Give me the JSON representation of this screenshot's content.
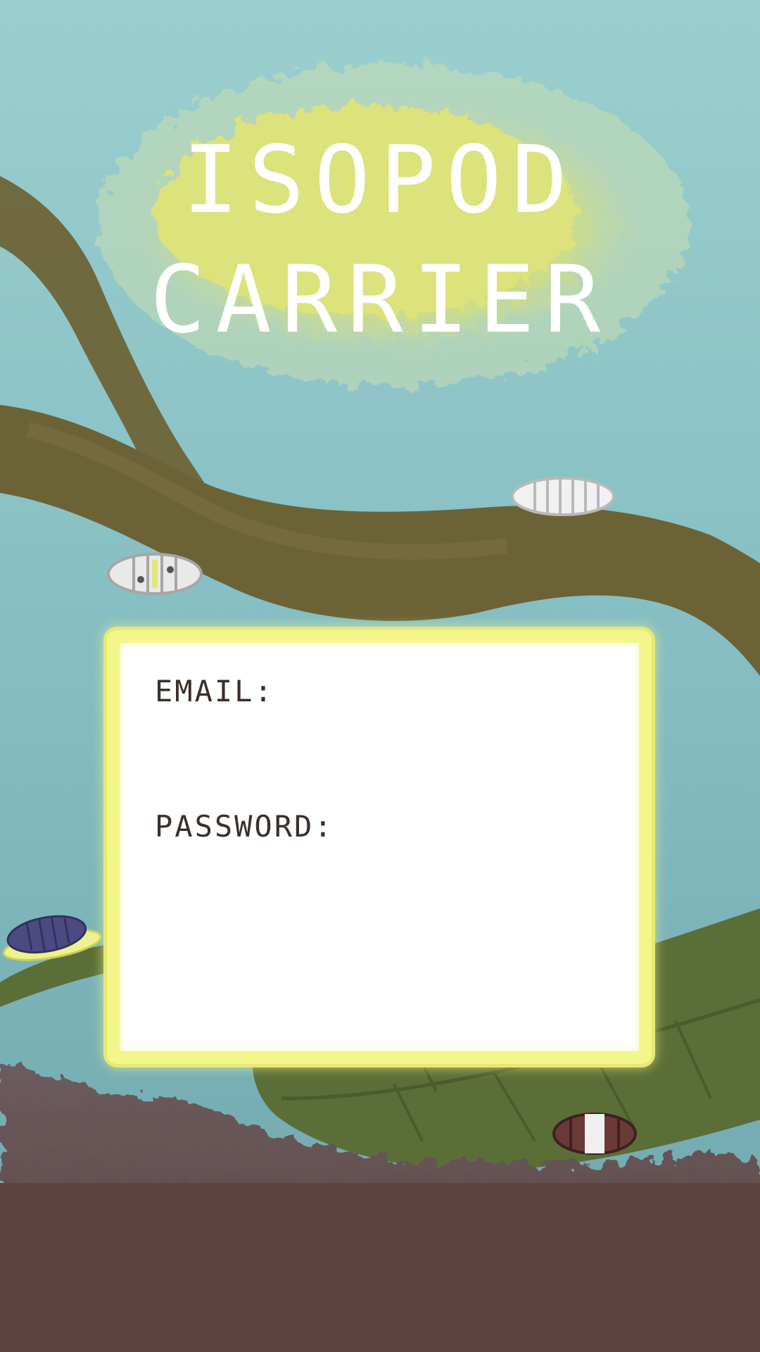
{
  "app": {
    "title_line1": "ISOPOD",
    "title_line2": "CARRIER"
  },
  "login": {
    "email_label": "EMAIL:",
    "email_value": "",
    "password_label": "PASSWORD:",
    "password_value": ""
  },
  "colors": {
    "sky": "#8cc3c6",
    "title_glow": "#dfe47a",
    "branch": "#6e6438",
    "leaf": "#5b6e37",
    "ground": "#5e4546",
    "card_border": "#f3f68a",
    "card_background": "#ffffff",
    "label_text": "#3a2f2a"
  },
  "decorations": {
    "isopods": [
      "white-isopod",
      "spotted-isopod",
      "purple-yellow-isopod",
      "brown-white-isopod"
    ]
  }
}
